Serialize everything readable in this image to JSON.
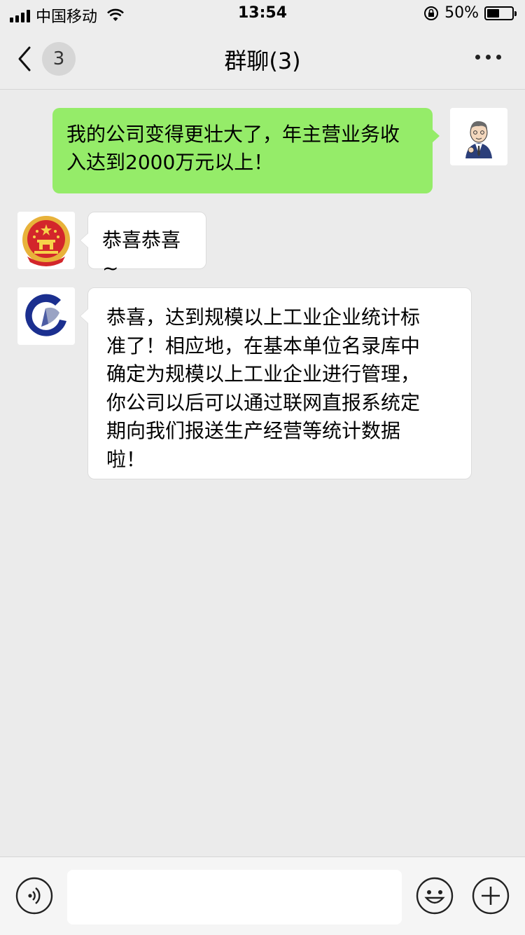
{
  "status_bar": {
    "carrier": "中国移动",
    "time": "13:54",
    "battery_text": "50%",
    "battery_level": 0.5
  },
  "nav": {
    "back_badge": "3",
    "title": "群聊(3)"
  },
  "messages": [
    {
      "side": "right",
      "avatar_icon": "cartoon-businessman-icon",
      "text": "我的公司变得更壮大了，年主营业务收入达到2000万元以上！"
    },
    {
      "side": "left",
      "avatar_icon": "national-emblem-icon",
      "text": "恭喜恭喜~"
    },
    {
      "side": "left",
      "avatar_icon": "statistics-logo-icon",
      "text": "恭喜，达到规模以上工业企业统计标准了！相应地，在基本单位名录库中确定为规模以上工业企业进行管理，你公司以后可以通过联网直报系统定期向我们报送生产经营等统计数据啦！"
    }
  ],
  "input_bar": {
    "placeholder": "",
    "voice_icon": "voice-icon",
    "emoji_icon": "emoji-icon",
    "plus_icon": "plus-icon"
  },
  "colors": {
    "background": "#ebebeb",
    "my_bubble": "#95ec69",
    "other_bubble": "#ffffff"
  }
}
